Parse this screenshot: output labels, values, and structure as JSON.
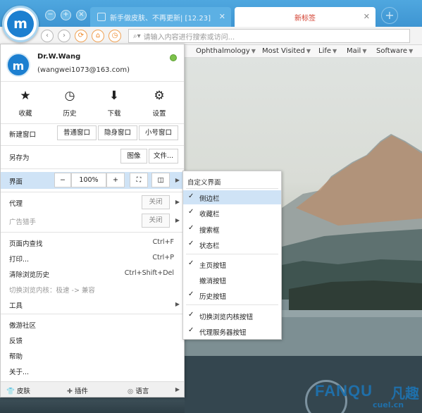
{
  "tabs": [
    {
      "title": "新手做皮肤、不再更新| [12.23]",
      "active": false
    },
    {
      "title": "新标签",
      "active": true
    }
  ],
  "window_controls": [
    "−",
    "+",
    "×"
  ],
  "address_bar": {
    "placeholder": "请输入内容进行搜索或访问..."
  },
  "bookmarks": [
    "Ophthalmology",
    "Most Visited",
    "Life",
    "Mail",
    "Software"
  ],
  "account": {
    "name": "Dr.W.Wang",
    "email": "(wangwei1073@163.com)"
  },
  "quick_actions": [
    {
      "label": "收藏",
      "icon": "star-icon"
    },
    {
      "label": "历史",
      "icon": "clock-icon"
    },
    {
      "label": "下载",
      "icon": "download-icon"
    },
    {
      "label": "设置",
      "icon": "gear-icon"
    }
  ],
  "new_window": {
    "label": "新建窗口",
    "normal": "普通窗口",
    "private": "隐身窗口",
    "small": "小号窗口"
  },
  "save_as": {
    "label": "另存为",
    "image": "图像",
    "file": "文件..."
  },
  "interface": {
    "label": "界面",
    "minus": "−",
    "zoom": "100%",
    "plus": "+"
  },
  "proxy": {
    "label": "代理",
    "state": "关闭"
  },
  "adblock": {
    "label": "广告猎手",
    "state": "关闭"
  },
  "menu_items": {
    "find": "页面内查找",
    "find_shortcut": "Ctrl+F",
    "print": "打印...",
    "print_shortcut": "Ctrl+P",
    "clear_history": "清除浏览历史",
    "clear_shortcut": "Ctrl+Shift+Del",
    "switch_kernel": "切换浏览内核：极速 -> 兼容",
    "tools": "工具",
    "community": "傲游社区",
    "feedback": "反馈",
    "help": "帮助",
    "about": "关于..."
  },
  "bottom_bar": {
    "skin": "皮肤",
    "plugins": "插件",
    "language": "语言"
  },
  "submenu": {
    "title": "自定义界面",
    "items": [
      {
        "label": "侧边栏",
        "checked": true
      },
      {
        "label": "收藏栏",
        "checked": true
      },
      {
        "label": "搜索框",
        "checked": true
      },
      {
        "label": "状态栏",
        "checked": true
      },
      {
        "label": "主页按钮",
        "checked": true
      },
      {
        "label": "撤消按钮",
        "checked": false
      },
      {
        "label": "历史按钮",
        "checked": true
      },
      {
        "label": "切换浏览内核按钮",
        "checked": true
      },
      {
        "label": "代理服务器按钮",
        "checked": true
      }
    ]
  },
  "watermark": {
    "brand": "FANQU",
    "cn": "凡趣",
    "url": "cuel.cn"
  },
  "colors": {
    "accent": "#3e95d2",
    "highlight": "#cfe3f6",
    "active_tab_text": "#d23c2c"
  }
}
